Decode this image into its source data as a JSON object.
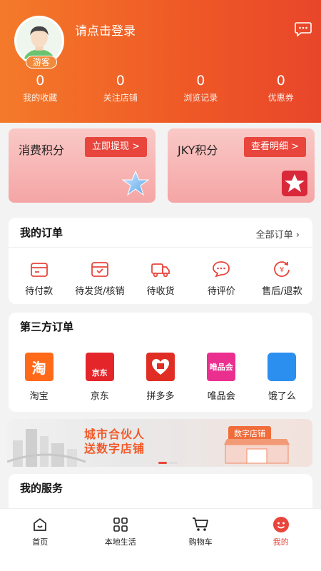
{
  "profile": {
    "login_text": "请点击登录",
    "guest_badge": "游客"
  },
  "stats": [
    {
      "value": "0",
      "label": "我的收藏"
    },
    {
      "value": "0",
      "label": "关注店铺"
    },
    {
      "value": "0",
      "label": "浏览记录"
    },
    {
      "value": "0",
      "label": "优惠券"
    }
  ],
  "points": {
    "consume": {
      "title": "消费积分",
      "button": "立即提现 >"
    },
    "jky": {
      "title": "JKY积分",
      "button": "查看明细 >"
    }
  },
  "my_orders": {
    "title": "我的订单",
    "all_link": "全部订单",
    "items": [
      {
        "label": "待付款",
        "icon": "wallet-icon"
      },
      {
        "label": "待发货/核销",
        "icon": "box-icon"
      },
      {
        "label": "待收货",
        "icon": "truck-icon"
      },
      {
        "label": "待评价",
        "icon": "comment-icon"
      },
      {
        "label": "售后/退款",
        "icon": "refund-icon"
      }
    ]
  },
  "third_orders": {
    "title": "第三方订单",
    "items": [
      {
        "label": "淘宝",
        "logo_text": "淘",
        "color": "#ff6a1a"
      },
      {
        "label": "京东",
        "logo_text": "京东",
        "color": "#e4262b"
      },
      {
        "label": "拼多多",
        "logo_text": "",
        "color": "#e02e24"
      },
      {
        "label": "唯品会",
        "logo_text": "唯品会",
        "color": "#ea2f8f"
      },
      {
        "label": "饿了么",
        "logo_text": "",
        "color": "#2b8ff0"
      }
    ]
  },
  "banner": {
    "line1": "城市合伙人",
    "line2": "送数字店铺",
    "tag": "数字店铺"
  },
  "services": {
    "title": "我的服务"
  },
  "tabbar": [
    {
      "label": "首页",
      "icon": "home-icon",
      "active": false
    },
    {
      "label": "本地生活",
      "icon": "grid-icon",
      "active": false
    },
    {
      "label": "购物车",
      "icon": "cart-icon",
      "active": false
    },
    {
      "label": "我的",
      "icon": "profile-icon",
      "active": true
    }
  ],
  "colors": {
    "brand": "#e8453c",
    "header_start": "#f47a2a",
    "header_end": "#e8462a"
  }
}
